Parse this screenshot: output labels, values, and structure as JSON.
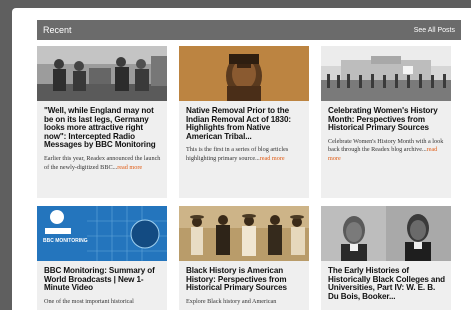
{
  "section": {
    "title": "Recent",
    "see_all_label": "See All Posts"
  },
  "colors": {
    "header_bar": "#6b6b6b",
    "card_bg": "#efefef",
    "read_more": "#e05a12"
  },
  "posts": [
    {
      "title": "\"Well, while England may not be on its last legs, Germany looks more attractive right now\": Intercepted Radio Messages by BBC Monitoring",
      "excerpt": "Earlier this year, Readex announced the launch of the newly-digitized BBC...",
      "read_more": "read more",
      "image_icon": "historical-photo-soldiers"
    },
    {
      "title": "Native Removal Prior to the Indian Removal Act of 1830: Highlights from Native American Tribal...",
      "excerpt": "This is the first in a series of blog articles highlighting primary source...",
      "read_more": "read more",
      "image_icon": "portrait-native-american"
    },
    {
      "title": "Celebrating Women's History Month: Perspectives from Historical Primary Sources",
      "excerpt": "Celebrate Women's History Month with a look back through the Readex blog archive...",
      "read_more": "read more",
      "image_icon": "historical-photo-white-house-protest"
    },
    {
      "title": "BBC Monitoring: Summary of World Broadcasts | New 1-Minute Video",
      "excerpt": "One of the most important historical",
      "read_more": "",
      "image_icon": "bbc-monitoring-graphic",
      "badge_text": "BBC MONITORING"
    },
    {
      "title": "Black History is American History: Perspectives from Historical Primary Sources",
      "excerpt": "Explore Black history and American",
      "read_more": "",
      "image_icon": "historical-photo-group"
    },
    {
      "title": "The Early Histories of Historically Black Colleges and Universities, Part IV: W. E. B. Du Bois, Booker...",
      "excerpt": "",
      "read_more": "",
      "image_icon": "portraits-du-bois-washington"
    }
  ]
}
